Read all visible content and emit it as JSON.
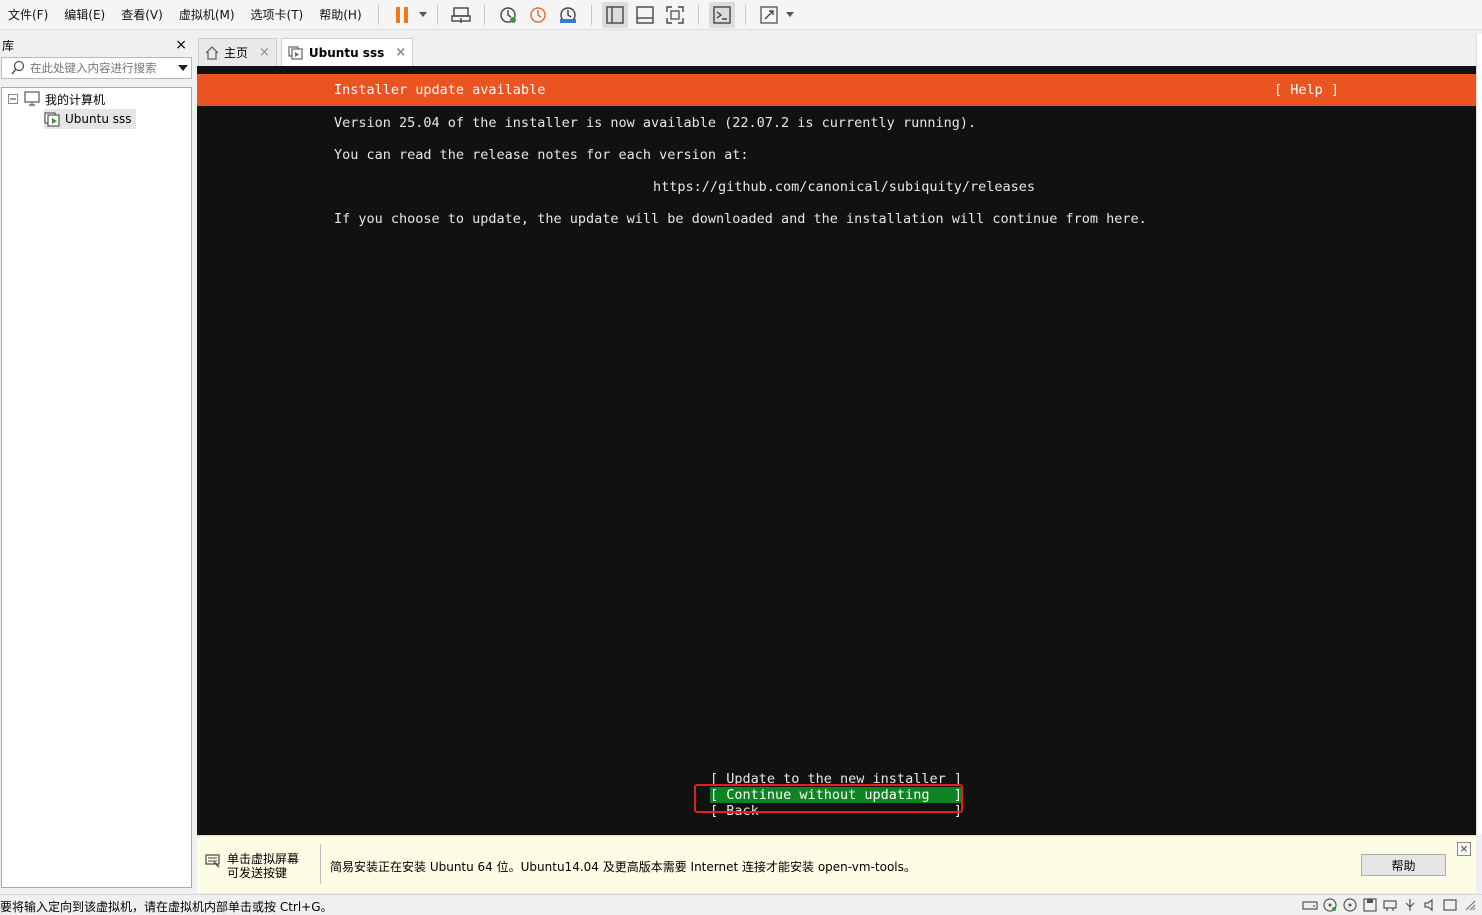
{
  "menu": [
    "文件(F)",
    "编辑(E)",
    "查看(V)",
    "虚拟机(M)",
    "选项卡(T)",
    "帮助(H)"
  ],
  "library": {
    "title": "库",
    "close": "×",
    "search_placeholder": "在此处键入内容进行搜索",
    "tree": {
      "root": "我的计算机",
      "child": "Ubuntu sss"
    }
  },
  "tabs": {
    "home": "主页",
    "vm": "Ubuntu sss",
    "close": "×"
  },
  "vm_screen": {
    "header_title": "Installer update available",
    "header_help": "[ Help ]",
    "line1": "Version 25.04 of the installer is now available (22.07.2 is currently running).",
    "line2": "You can read the release notes for each version at:",
    "url": "https://github.com/canonical/subiquity/releases",
    "line3": "If you choose to update, the update will be downloaded and the installation will continue from here.",
    "buttons": [
      "[ Update to the new installer ]",
      "[ Continue without updating   ]",
      "[ Back                        ]"
    ]
  },
  "hint_bar": {
    "left_line1": "单击虚拟屏幕",
    "left_line2": "可发送按键",
    "message": "简易安装正在安装 Ubuntu 64 位。Ubuntu14.04 及更高版本需要 Internet 连接才能安装 open-vm-tools。",
    "help_button": "帮助",
    "close": "×"
  },
  "status_bar": {
    "text": "要将输入定向到该虚拟机，请在虚拟机内部单击或按 Ctrl+G。"
  },
  "colors": {
    "ubuntu_orange": "#e95420",
    "selected_green": "#0e8420",
    "highlight_red": "#e81d1d",
    "pause_orange": "#f07a1a"
  }
}
